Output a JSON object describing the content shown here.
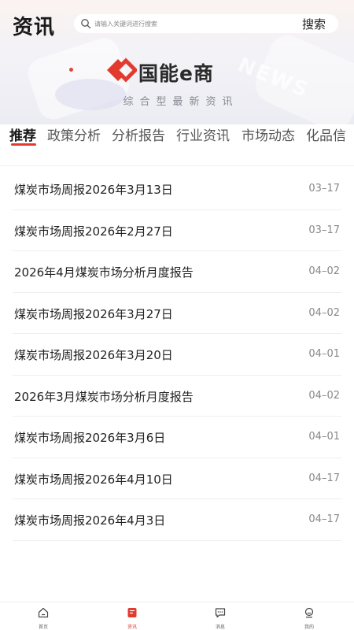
{
  "header": {
    "title": "资讯",
    "search_placeholder": "请输入关键词进行搜索",
    "search_button": "搜索"
  },
  "banner": {
    "brand": "国能e商",
    "slogan": "综合型最新资讯",
    "watermark": "NEWS",
    "brand_color": "#e23a2e"
  },
  "tabs": [
    {
      "label": "推荐",
      "active": true
    },
    {
      "label": "政策分析",
      "active": false
    },
    {
      "label": "分析报告",
      "active": false
    },
    {
      "label": "行业资讯",
      "active": false
    },
    {
      "label": "市场动态",
      "active": false
    },
    {
      "label": "化品信",
      "active": false
    }
  ],
  "articles": [
    {
      "title": "煤炭市场周报2026年3月13日",
      "date": "03–17"
    },
    {
      "title": "煤炭市场周报2026年2月27日",
      "date": "03–17"
    },
    {
      "title": "2026年4月煤炭市场分析月度报告",
      "date": "04–02"
    },
    {
      "title": "煤炭市场周报2026年3月27日",
      "date": "04–02"
    },
    {
      "title": "煤炭市场周报2026年3月20日",
      "date": "04–01"
    },
    {
      "title": "2026年3月煤炭市场分析月度报告",
      "date": "04–02"
    },
    {
      "title": "煤炭市场周报2026年3月6日",
      "date": "04–01"
    },
    {
      "title": "煤炭市场周报2026年4月10日",
      "date": "04–17"
    },
    {
      "title": "煤炭市场周报2026年4月3日",
      "date": "04–17"
    }
  ],
  "bottom_nav": [
    {
      "label": "首页",
      "icon": "home-icon",
      "active": false
    },
    {
      "label": "资讯",
      "icon": "news-icon",
      "active": true
    },
    {
      "label": "消息",
      "icon": "message-icon",
      "active": false
    },
    {
      "label": "我的",
      "icon": "profile-icon",
      "active": false
    }
  ],
  "colors": {
    "accent": "#e23a2e",
    "text": "#222222",
    "muted": "#888888"
  }
}
